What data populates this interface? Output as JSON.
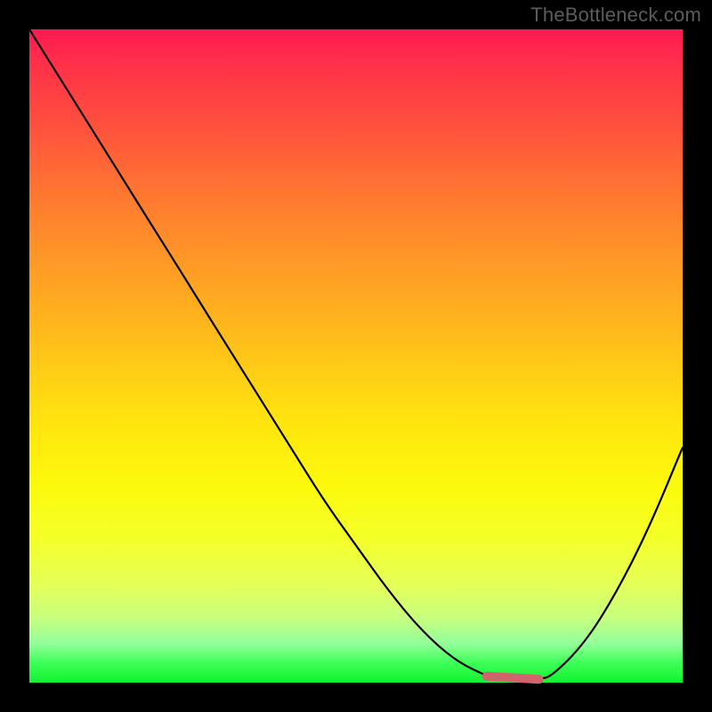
{
  "watermark": "TheBottleneck.com",
  "colors": {
    "frame": "#000000",
    "gradient_top": "#ff1a52",
    "gradient_mid": "#ffe40e",
    "gradient_bottom": "#13f22e",
    "curve": "#000000",
    "minimum_marker": "#d1626e"
  },
  "chart_data": {
    "type": "line",
    "title": "",
    "xlabel": "",
    "ylabel": "",
    "xlim": [
      0,
      100
    ],
    "ylim": [
      0,
      100
    ],
    "grid": false,
    "x": [
      0,
      5,
      10,
      15,
      20,
      25,
      30,
      35,
      40,
      45,
      50,
      55,
      60,
      65,
      70,
      72,
      75,
      78,
      80,
      85,
      90,
      95,
      100
    ],
    "values": [
      100,
      92,
      84,
      76,
      68,
      60,
      52,
      44,
      36,
      28,
      21,
      14,
      8,
      3.5,
      1,
      0.5,
      0.5,
      0.5,
      1,
      6,
      14,
      24,
      36
    ],
    "minimum_band_x": [
      70,
      78
    ],
    "note": "Values are relative plot-area coordinates (0=bottom, 100=top). Steep descending limb from top-left into a flat minimum band around x≈70–78 near y≈0, then rising to the right edge at y≈36."
  }
}
